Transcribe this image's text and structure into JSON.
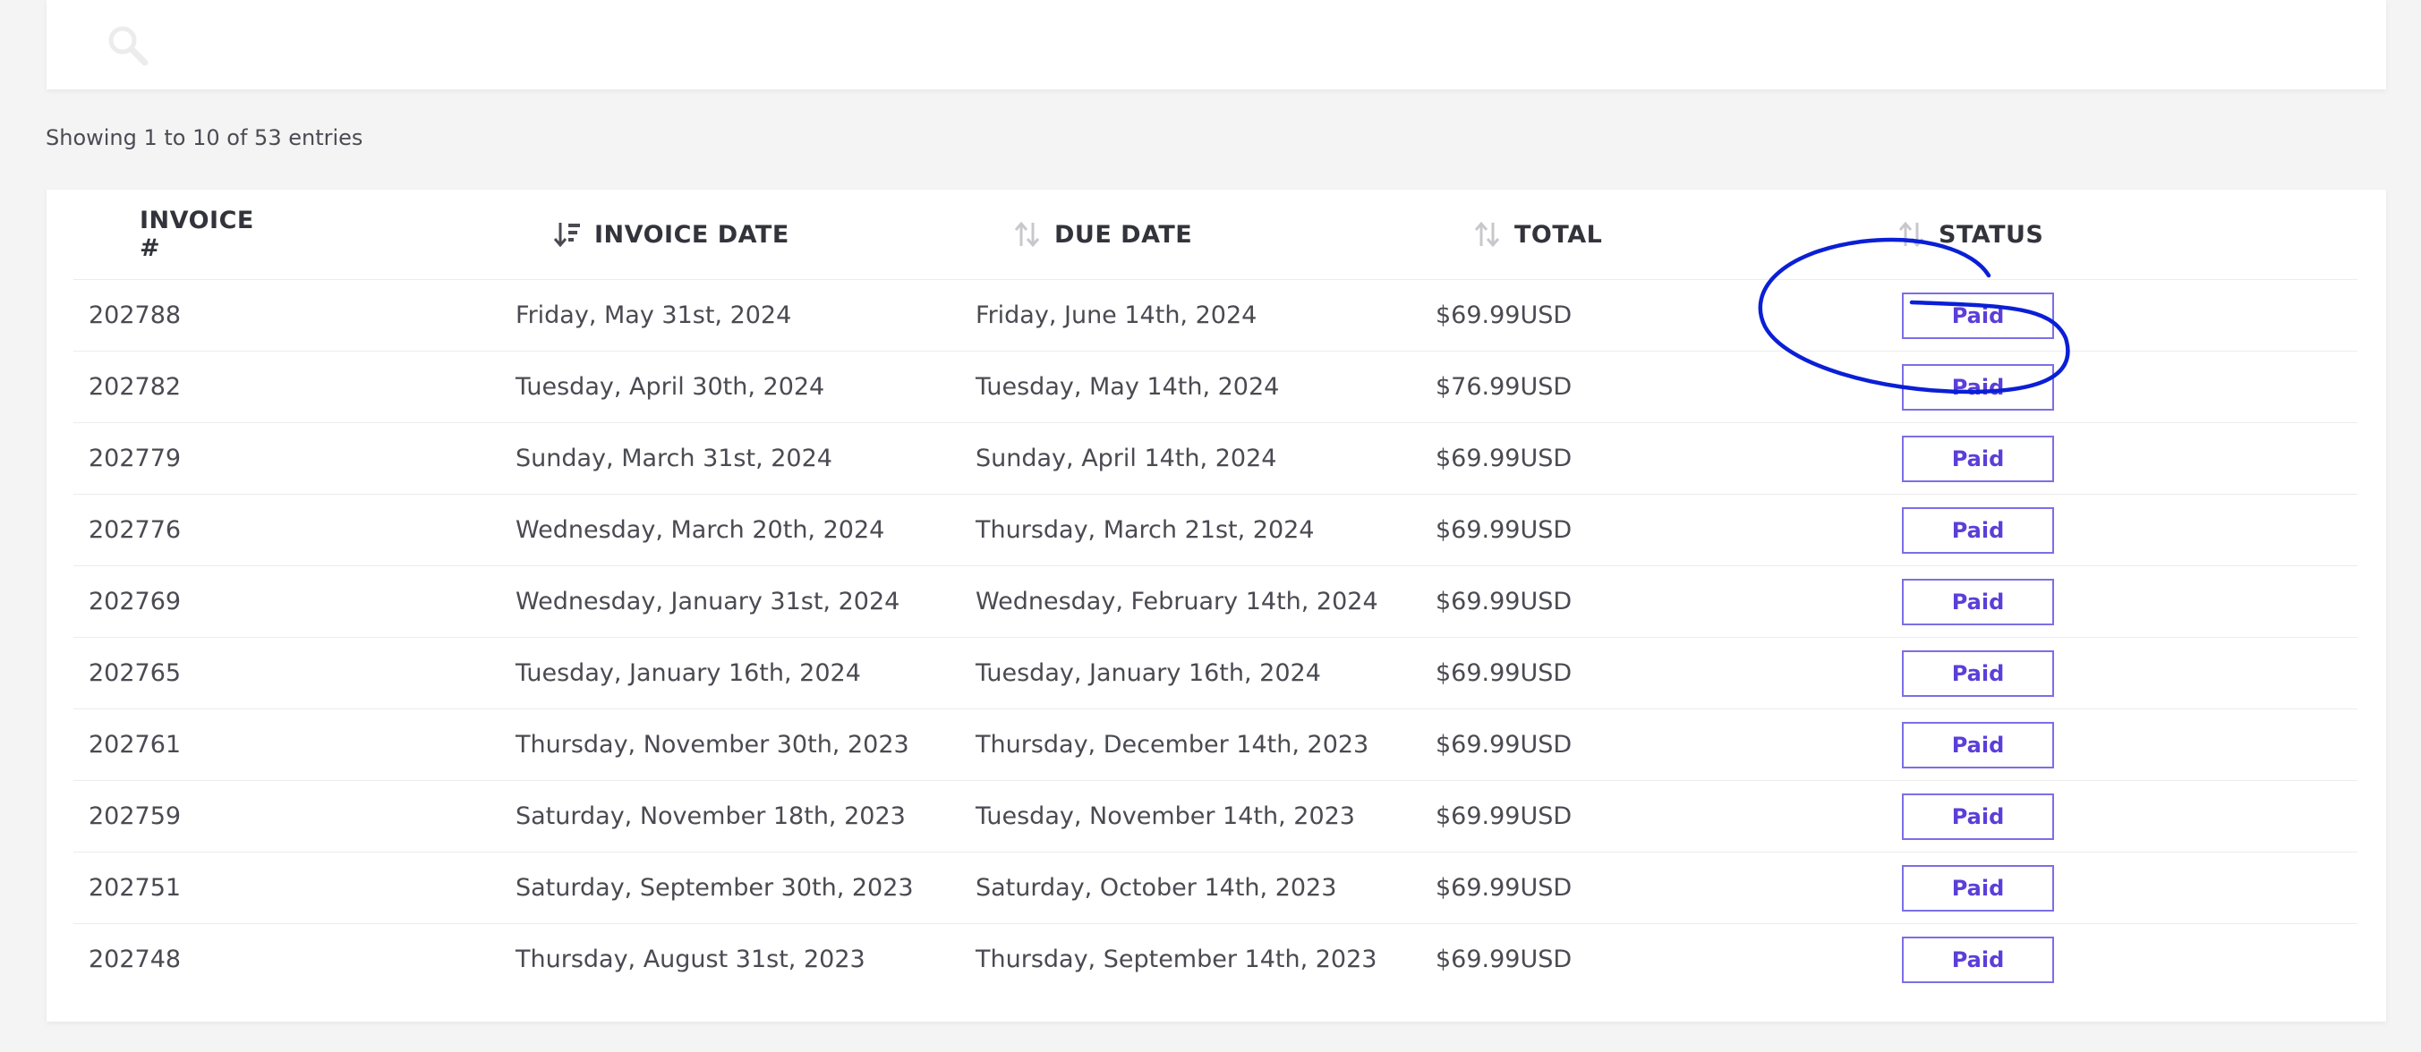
{
  "search": {
    "value": "",
    "placeholder": ""
  },
  "entries_info": "Showing 1 to 10 of 53 entries",
  "table": {
    "columns": [
      {
        "label": "INVOICE #",
        "sort": "none"
      },
      {
        "label": "INVOICE DATE",
        "sort": "desc"
      },
      {
        "label": "DUE DATE",
        "sort": "none"
      },
      {
        "label": "TOTAL",
        "sort": "none"
      },
      {
        "label": "STATUS",
        "sort": "none"
      }
    ],
    "rows": [
      {
        "invoice": "202788",
        "invoice_date": "Friday, May 31st, 2024",
        "due_date": "Friday, June 14th, 2024",
        "total": "$69.99USD",
        "status": "Paid"
      },
      {
        "invoice": "202782",
        "invoice_date": "Tuesday, April 30th, 2024",
        "due_date": "Tuesday, May 14th, 2024",
        "total": "$76.99USD",
        "status": "Paid"
      },
      {
        "invoice": "202779",
        "invoice_date": "Sunday, March 31st, 2024",
        "due_date": "Sunday, April 14th, 2024",
        "total": "$69.99USD",
        "status": "Paid"
      },
      {
        "invoice": "202776",
        "invoice_date": "Wednesday, March 20th, 2024",
        "due_date": "Thursday, March 21st, 2024",
        "total": "$69.99USD",
        "status": "Paid"
      },
      {
        "invoice": "202769",
        "invoice_date": "Wednesday, January 31st, 2024",
        "due_date": "Wednesday, February 14th, 2024",
        "total": "$69.99USD",
        "status": "Paid"
      },
      {
        "invoice": "202765",
        "invoice_date": "Tuesday, January 16th, 2024",
        "due_date": "Tuesday, January 16th, 2024",
        "total": "$69.99USD",
        "status": "Paid"
      },
      {
        "invoice": "202761",
        "invoice_date": "Thursday, November 30th, 2023",
        "due_date": "Thursday, December 14th, 2023",
        "total": "$69.99USD",
        "status": "Paid"
      },
      {
        "invoice": "202759",
        "invoice_date": "Saturday, November 18th, 2023",
        "due_date": "Tuesday, November 14th, 2023",
        "total": "$69.99USD",
        "status": "Paid"
      },
      {
        "invoice": "202751",
        "invoice_date": "Saturday, September 30th, 2023",
        "due_date": "Saturday, October 14th, 2023",
        "total": "$69.99USD",
        "status": "Paid"
      },
      {
        "invoice": "202748",
        "invoice_date": "Thursday, August 31st, 2023",
        "due_date": "Thursday, September 14th, 2023",
        "total": "$69.99USD",
        "status": "Paid"
      }
    ]
  },
  "icons": {
    "search": "search-icon",
    "sort": "sort-icon",
    "sort_desc": "sort-desc-icon"
  },
  "colors": {
    "background": "#f5f4f4",
    "card": "#ffffff",
    "badge_border": "#7c6ee6",
    "badge_text": "#5b3fd8",
    "annotation_ink": "#0a1fd6"
  }
}
